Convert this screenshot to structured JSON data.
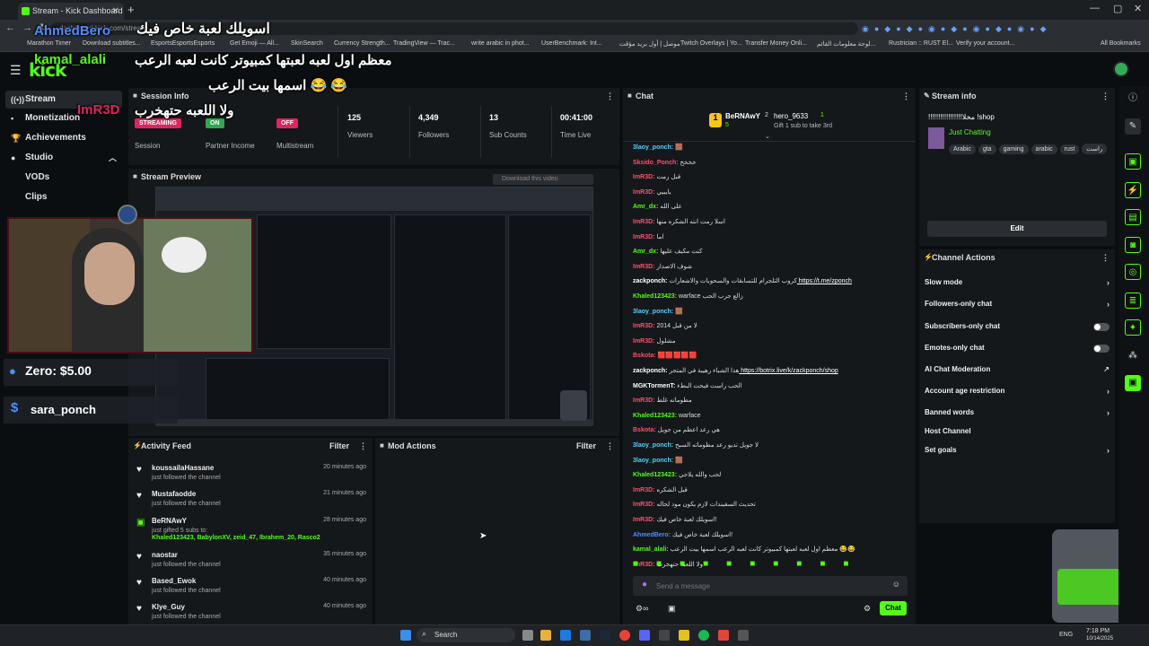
{
  "browser": {
    "tab_title": "Stream - Kick Dashboard",
    "url": "dashboard.kick.com/stream",
    "bookmarks": [
      "Marathon Timer",
      "Download subtitles...",
      "EsportsEsportsEsports",
      "Get Emoji — All...",
      "SkinSearch",
      "Currency Strength...",
      "TradingView — Trac...",
      "write arabic in phot...",
      "UserBenchmark: Int...",
      "موصل | أول بريد مؤقت",
      "Twitch Overlays | Yo...",
      "Transfer Money Onli...",
      "لوحة معلومات القائم...",
      "Rustrician :: RUST El...",
      "Verify your account...",
      "All Bookmarks"
    ]
  },
  "header": {
    "logo": "kick"
  },
  "sidebar": {
    "items": [
      {
        "label": "Stream",
        "icon": "broadcast-icon"
      },
      {
        "label": "Monetization",
        "icon": "dollar-icon"
      },
      {
        "label": "Achievements",
        "icon": "trophy-icon"
      },
      {
        "label": "Studio",
        "icon": "studio-icon"
      },
      {
        "label": "VODs"
      },
      {
        "label": "Clips"
      }
    ]
  },
  "session": {
    "title": "Session Info",
    "session_badge": "STREAMING",
    "session_label": "Session",
    "partner_badge": "ON",
    "partner_label": "Partner Income",
    "multistream_badge": "OFF",
    "multistream_label": "Multistream",
    "viewers": "125",
    "viewers_label": "Viewers",
    "followers": "4,349",
    "followers_label": "Followers",
    "subs": "13",
    "subs_label": "Sub Counts",
    "time": "00:41:00",
    "time_label": "Time Live"
  },
  "overlay": {
    "line1": "اسويلك لعبة خاص فيك",
    "name1": "AhmedBero",
    "name2": "kamal_alali",
    "line2": "معظم اول لعبه لعبتها كمبيوتر كانت لعبه الرعب",
    "line3": "اسمها بيت الرعب 😂 😂",
    "name3": "ImR3D",
    "line4": "ولا اللعبه حتهخرب",
    "donation": "Zero: $5.00",
    "donor": "sara_ponch"
  },
  "preview": {
    "title": "Stream Preview",
    "download": "Download this video"
  },
  "activity": {
    "title": "Activity Feed",
    "filter": "Filter",
    "items": [
      {
        "name": "koussailaHassane",
        "desc": "just followed the channel",
        "time": "20 minutes ago"
      },
      {
        "name": "Mustafaodde",
        "desc": "just followed the channel",
        "time": "21 minutes ago"
      },
      {
        "name": "BeRNAwY",
        "desc": "just gifted 5 subs to:",
        "extra": "Khaled123423, BabylonXV, zeid_47, Ibrahem_20, Rasco2",
        "time": "28 minutes ago"
      },
      {
        "name": "naostar",
        "desc": "just followed the channel",
        "time": "35 minutes ago"
      },
      {
        "name": "Based_Ewok",
        "desc": "just followed the channel",
        "time": "40 minutes ago"
      },
      {
        "name": "Klye_Guy",
        "desc": "just followed the channel",
        "time": "40 minutes ago"
      }
    ]
  },
  "mod": {
    "title": "Mod Actions",
    "filter": "Filter"
  },
  "chat": {
    "title": "Chat",
    "gifter1": "BeRNAwY",
    "gifter1_count": "5",
    "gifter2": "hero_9633",
    "gifter2_count": "1",
    "gift_prompt": "Gift 1 sub to take 3rd",
    "lines": [
      {
        "user": "3laoy_ponch:",
        "msg": "🟫",
        "color": "#4fd1ff"
      },
      {
        "user": "Sksido_Ponch:",
        "msg": "خخخخ",
        "color": "#ff4d6d"
      },
      {
        "user": "ImR3D:",
        "msg": "قبل رمت",
        "color": "#ff4d6d"
      },
      {
        "user": "ImR3D:",
        "msg": "يايبيي",
        "color": "#ff4d6d"
      },
      {
        "user": "Amr_dx:",
        "msg": "على الله",
        "color": "#53fc18"
      },
      {
        "user": "ImR3D:",
        "msg": "اسلا رمت انته الشكره منها",
        "color": "#ff4d6d"
      },
      {
        "user": "ImR3D:",
        "msg": "اما",
        "color": "#ff4d6d"
      },
      {
        "user": "Amr_dx:",
        "msg": "كنت مكيف عليها",
        "color": "#53fc18"
      },
      {
        "user": "ImR3D:",
        "msg": "شوف الاصدار",
        "color": "#ff4d6d"
      },
      {
        "user": "zackponch:",
        "msg": "كروب التلجرام للتسابقات والسحوبات والاشعارات",
        "link": "https://t.me/zponch",
        "color": "#fff"
      },
      {
        "user": "Khaled123423:",
        "msg": "warface زالع جرب الحب",
        "color": "#53fc18"
      },
      {
        "user": "3laoy_ponch:",
        "msg": "🟫",
        "color": "#4fd1ff"
      },
      {
        "user": "ImR3D:",
        "msg": "2014 لا من قبل",
        "color": "#ff4d6d"
      },
      {
        "user": "ImR3D:",
        "msg": "مشلول",
        "color": "#ff4d6d"
      },
      {
        "user": "Bskota:",
        "msg": "🟥🟥🟥🟥🟥",
        "color": "#ff4d6d"
      },
      {
        "user": "zackponch:",
        "msg": "هذا الشباء رهيبة في المتجر",
        "link": "https://botrix.live/k/zackponch/shop",
        "color": "#fff"
      },
      {
        "user": "MGKTormenT:",
        "msg": "الحب راست فيحت البطء",
        "color": "#fff"
      },
      {
        "user": "ImR3D:",
        "msg": "مطوماته غلط",
        "color": "#ff4d6d"
      },
      {
        "user": "Khaled123423:",
        "msg": "warface",
        "color": "#53fc18"
      },
      {
        "user": "Bskota:",
        "msg": "هي رعد اعظم من جويل",
        "color": "#ff4d6d"
      },
      {
        "user": "3laoy_ponch:",
        "msg": "لا جويل تديو رعد مطوماته السبح",
        "color": "#4fd1ff"
      },
      {
        "user": "3laoy_ponch:",
        "msg": "🟫",
        "color": "#4fd1ff"
      },
      {
        "user": "Khaled123423:",
        "msg": "لحب والله يلاجي",
        "color": "#53fc18"
      },
      {
        "user": "ImR3D:",
        "msg": "قبل الشكره",
        "color": "#ff4d6d"
      },
      {
        "user": "ImR3D:",
        "msg": "تحديث السفيندات لازم يكون مود لحاله",
        "color": "#ff4d6d"
      },
      {
        "user": "ImR3D:",
        "msg": "اسويلك لعبة خاص فيك!",
        "color": "#ff4d6d"
      },
      {
        "user": "AhmedBero:",
        "msg": "اسويلك لعبة خاص فيك!",
        "color": "#4f8dff"
      },
      {
        "user": "kamal_alali:",
        "msg": "معظم اول لعبه لعبتها كمبيوتر كانت لعبه الرعب اسمها بيت الرعب 😂😂",
        "color": "#53fc18"
      },
      {
        "user": "ImR3D:",
        "msg": "ولا اللعبه حتهخرب",
        "color": "#ff4d6d"
      }
    ],
    "placeholder": "Send a message",
    "send": "Chat"
  },
  "stream_info": {
    "title": "Stream info",
    "stream_title": "!!!!!!!!!!!!!!!!!مخلا !shop",
    "category": "Just Chatting",
    "tags": [
      "Arabic",
      "gta",
      "gaming",
      "arabic",
      "rust",
      "راست"
    ],
    "edit": "Edit"
  },
  "channel_actions": {
    "title": "Channel Actions",
    "items": [
      {
        "label": "Slow mode",
        "ctl": "chevron"
      },
      {
        "label": "Followers-only chat",
        "ctl": "chevron"
      },
      {
        "label": "Subscribers-only chat",
        "ctl": "toggle"
      },
      {
        "label": "Emotes-only chat",
        "ctl": "toggle"
      },
      {
        "label": "AI Chat Moderation",
        "ctl": "external"
      },
      {
        "label": "Account age restriction",
        "ctl": "chevron"
      },
      {
        "label": "Banned words",
        "ctl": "chevron"
      },
      {
        "label": "Host Channel",
        "ctl": "none"
      },
      {
        "label": "Set goals",
        "ctl": "chevron"
      }
    ]
  },
  "taskbar": {
    "search": "Search",
    "lang": "ENG",
    "time": "7:18 PM",
    "date": "10/14/2025"
  },
  "colors": {
    "accent": "#53fc18",
    "panel": "#15181b",
    "bg": "#0b0e11"
  }
}
